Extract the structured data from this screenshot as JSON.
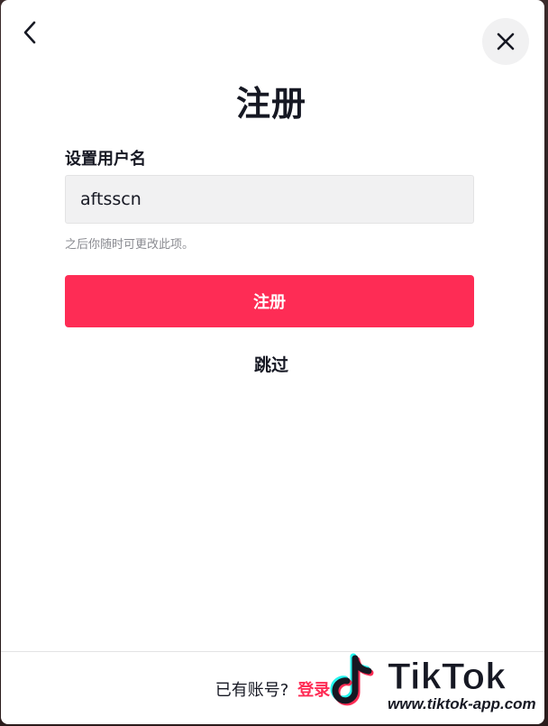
{
  "modal": {
    "title": "注册",
    "username_label": "设置用户名",
    "username_value": "aftsscn",
    "hint": "之后你随时可更改此项。",
    "signup_button": "注册",
    "skip_link": "跳过",
    "footer_prompt": "已有账号?",
    "footer_login_link": "登录"
  },
  "watermark": {
    "brand": "TikTok",
    "url": "www.tiktok-app.com"
  },
  "icons": {
    "back": "chevron-left-icon",
    "close": "close-icon",
    "logo": "tiktok-logo-icon"
  },
  "colors": {
    "primary": "#fe2c55",
    "text": "#161823",
    "input_bg": "#f1f1f2",
    "hint": "#8a8b91"
  }
}
